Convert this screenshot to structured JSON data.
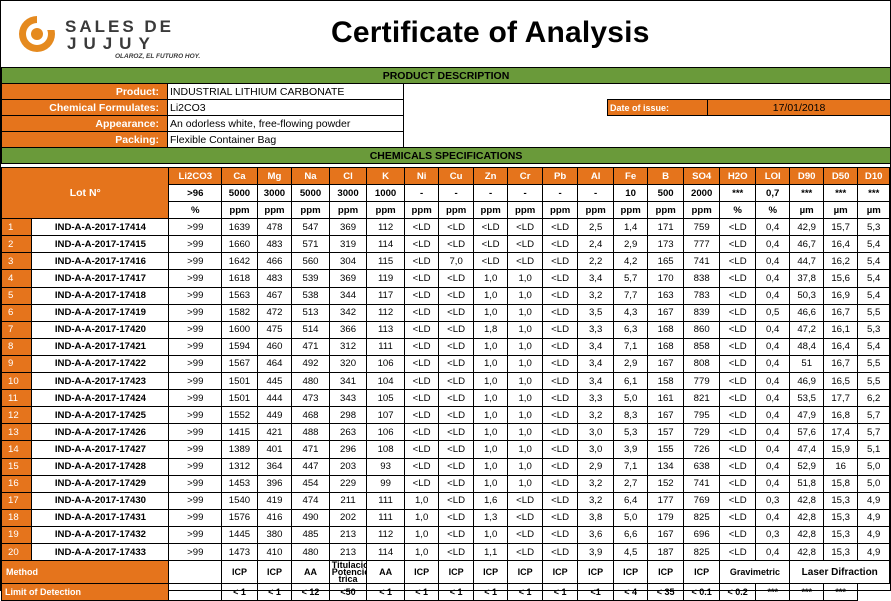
{
  "brand": {
    "line1": "SALES DE",
    "line2": "JUJUY",
    "tagline": "OLAROZ, EL FUTURO HOY."
  },
  "title": "Certificate of Analysis",
  "product_description_title": "PRODUCT DESCRIPTION",
  "product": {
    "label": "Product:",
    "value": "INDUSTRIAL LITHIUM CARBONATE"
  },
  "formula": {
    "label": "Chemical Formulates:",
    "value": "Li2CO3"
  },
  "appearance": {
    "label": "Appearance:",
    "value": "An odorless white, free-flowing powder"
  },
  "packing": {
    "label": "Packing:",
    "value": "Flexible Container Bag"
  },
  "date_of_issue": {
    "label": "Date of issue:",
    "value": "17/01/2018"
  },
  "specs_title": "CHEMICALS SPECIFICATIONS",
  "lot_header": "Lot N°",
  "columns": [
    "Li2CO3",
    "Ca",
    "Mg",
    "Na",
    "Cl",
    "K",
    "Ni",
    "Cu",
    "Zn",
    "Cr",
    "Pb",
    "Al",
    "Fe",
    "B",
    "SO4",
    "H2O",
    "LOI",
    "D90",
    "D50",
    "D10"
  ],
  "spec_limits": [
    ">96",
    "5000",
    "3000",
    "5000",
    "3000",
    "1000",
    "-",
    "-",
    "-",
    "-",
    "-",
    "-",
    "10",
    "500",
    "2000",
    "***",
    "0,7",
    "***",
    "***",
    "***"
  ],
  "units": [
    "%",
    "ppm",
    "ppm",
    "ppm",
    "ppm",
    "ppm",
    "ppm",
    "ppm",
    "ppm",
    "ppm",
    "ppm",
    "ppm",
    "ppm",
    "ppm",
    "ppm",
    "%",
    "%",
    "µm",
    "µm",
    "µm"
  ],
  "rows": [
    {
      "n": "1",
      "lot": "IND-A-A-2017-17414",
      "v": [
        ">99",
        "1639",
        "478",
        "547",
        "369",
        "112",
        "<LD",
        "<LD",
        "<LD",
        "<LD",
        "<LD",
        "2,5",
        "1,4",
        "171",
        "759",
        "<LD",
        "0,4",
        "42,9",
        "15,7",
        "5,3"
      ]
    },
    {
      "n": "2",
      "lot": "IND-A-A-2017-17415",
      "v": [
        ">99",
        "1660",
        "483",
        "571",
        "319",
        "114",
        "<LD",
        "<LD",
        "<LD",
        "<LD",
        "<LD",
        "2,4",
        "2,9",
        "173",
        "777",
        "<LD",
        "0,4",
        "46,7",
        "16,4",
        "5,4"
      ]
    },
    {
      "n": "3",
      "lot": "IND-A-A-2017-17416",
      "v": [
        ">99",
        "1642",
        "466",
        "560",
        "304",
        "115",
        "<LD",
        "7,0",
        "<LD",
        "<LD",
        "<LD",
        "2,2",
        "4,2",
        "165",
        "741",
        "<LD",
        "0,4",
        "44,7",
        "16,2",
        "5,4"
      ]
    },
    {
      "n": "4",
      "lot": "IND-A-A-2017-17417",
      "v": [
        ">99",
        "1618",
        "483",
        "539",
        "369",
        "119",
        "<LD",
        "<LD",
        "1,0",
        "1,0",
        "<LD",
        "3,4",
        "5,7",
        "170",
        "838",
        "<LD",
        "0,4",
        "37,8",
        "15,6",
        "5,4"
      ]
    },
    {
      "n": "5",
      "lot": "IND-A-A-2017-17418",
      "v": [
        ">99",
        "1563",
        "467",
        "538",
        "344",
        "117",
        "<LD",
        "<LD",
        "1,0",
        "1,0",
        "<LD",
        "3,2",
        "7,7",
        "163",
        "783",
        "<LD",
        "0,4",
        "50,3",
        "16,9",
        "5,4"
      ]
    },
    {
      "n": "6",
      "lot": "IND-A-A-2017-17419",
      "v": [
        ">99",
        "1582",
        "472",
        "513",
        "342",
        "112",
        "<LD",
        "<LD",
        "1,0",
        "1,0",
        "<LD",
        "3,5",
        "4,3",
        "167",
        "839",
        "<LD",
        "0,5",
        "46,6",
        "16,7",
        "5,5"
      ]
    },
    {
      "n": "7",
      "lot": "IND-A-A-2017-17420",
      "v": [
        ">99",
        "1600",
        "475",
        "514",
        "366",
        "113",
        "<LD",
        "<LD",
        "1,8",
        "1,0",
        "<LD",
        "3,3",
        "6,3",
        "168",
        "860",
        "<LD",
        "0,4",
        "47,2",
        "16,1",
        "5,3"
      ]
    },
    {
      "n": "8",
      "lot": "IND-A-A-2017-17421",
      "v": [
        ">99",
        "1594",
        "460",
        "471",
        "312",
        "111",
        "<LD",
        "<LD",
        "1,0",
        "1,0",
        "<LD",
        "3,4",
        "7,1",
        "168",
        "858",
        "<LD",
        "0,4",
        "48,4",
        "16,4",
        "5,4"
      ]
    },
    {
      "n": "9",
      "lot": "IND-A-A-2017-17422",
      "v": [
        ">99",
        "1567",
        "464",
        "492",
        "320",
        "106",
        "<LD",
        "<LD",
        "1,0",
        "1,0",
        "<LD",
        "3,4",
        "2,9",
        "167",
        "808",
        "<LD",
        "0,4",
        "51",
        "16,7",
        "5,5"
      ]
    },
    {
      "n": "10",
      "lot": "IND-A-A-2017-17423",
      "v": [
        ">99",
        "1501",
        "445",
        "480",
        "341",
        "104",
        "<LD",
        "<LD",
        "1,0",
        "1,0",
        "<LD",
        "3,4",
        "6,1",
        "158",
        "779",
        "<LD",
        "0,4",
        "46,9",
        "16,5",
        "5,5"
      ]
    },
    {
      "n": "11",
      "lot": "IND-A-A-2017-17424",
      "v": [
        ">99",
        "1501",
        "444",
        "473",
        "343",
        "105",
        "<LD",
        "<LD",
        "1,0",
        "1,0",
        "<LD",
        "3,3",
        "5,0",
        "161",
        "821",
        "<LD",
        "0,4",
        "53,5",
        "17,7",
        "6,2"
      ]
    },
    {
      "n": "12",
      "lot": "IND-A-A-2017-17425",
      "v": [
        ">99",
        "1552",
        "449",
        "468",
        "298",
        "107",
        "<LD",
        "<LD",
        "1,0",
        "1,0",
        "<LD",
        "3,2",
        "8,3",
        "167",
        "795",
        "<LD",
        "0,4",
        "47,9",
        "16,8",
        "5,7"
      ]
    },
    {
      "n": "13",
      "lot": "IND-A-A-2017-17426",
      "v": [
        ">99",
        "1415",
        "421",
        "488",
        "263",
        "106",
        "<LD",
        "<LD",
        "1,0",
        "1,0",
        "<LD",
        "3,0",
        "5,3",
        "157",
        "729",
        "<LD",
        "0,4",
        "57,6",
        "17,4",
        "5,7"
      ]
    },
    {
      "n": "14",
      "lot": "IND-A-A-2017-17427",
      "v": [
        ">99",
        "1389",
        "401",
        "471",
        "296",
        "108",
        "<LD",
        "<LD",
        "1,0",
        "1,0",
        "<LD",
        "3,0",
        "3,9",
        "155",
        "726",
        "<LD",
        "0,4",
        "47,4",
        "15,9",
        "5,1"
      ]
    },
    {
      "n": "15",
      "lot": "IND-A-A-2017-17428",
      "v": [
        ">99",
        "1312",
        "364",
        "447",
        "203",
        "93",
        "<LD",
        "<LD",
        "1,0",
        "1,0",
        "<LD",
        "2,9",
        "7,1",
        "134",
        "638",
        "<LD",
        "0,4",
        "52,9",
        "16",
        "5,0"
      ]
    },
    {
      "n": "16",
      "lot": "IND-A-A-2017-17429",
      "v": [
        ">99",
        "1453",
        "396",
        "454",
        "229",
        "99",
        "<LD",
        "<LD",
        "1,0",
        "1,0",
        "<LD",
        "3,2",
        "2,7",
        "152",
        "741",
        "<LD",
        "0,4",
        "51,8",
        "15,8",
        "5,0"
      ]
    },
    {
      "n": "17",
      "lot": "IND-A-A-2017-17430",
      "v": [
        ">99",
        "1540",
        "419",
        "474",
        "211",
        "111",
        "1,0",
        "<LD",
        "1,6",
        "<LD",
        "<LD",
        "3,2",
        "6,4",
        "177",
        "769",
        "<LD",
        "0,3",
        "42,8",
        "15,3",
        "4,9"
      ]
    },
    {
      "n": "18",
      "lot": "IND-A-A-2017-17431",
      "v": [
        ">99",
        "1576",
        "416",
        "490",
        "202",
        "111",
        "1,0",
        "<LD",
        "1,3",
        "<LD",
        "<LD",
        "3,8",
        "5,0",
        "179",
        "825",
        "<LD",
        "0,4",
        "42,8",
        "15,3",
        "4,9"
      ]
    },
    {
      "n": "19",
      "lot": "IND-A-A-2017-17432",
      "v": [
        ">99",
        "1445",
        "380",
        "485",
        "213",
        "112",
        "1,0",
        "<LD",
        "1,0",
        "<LD",
        "<LD",
        "3,6",
        "6,6",
        "167",
        "696",
        "<LD",
        "0,3",
        "42,8",
        "15,3",
        "4,9"
      ]
    },
    {
      "n": "20",
      "lot": "IND-A-A-2017-17433",
      "v": [
        ">99",
        "1473",
        "410",
        "480",
        "213",
        "114",
        "1,0",
        "<LD",
        "1,1",
        "<LD",
        "<LD",
        "3,9",
        "4,5",
        "187",
        "825",
        "<LD",
        "0,4",
        "42,8",
        "15,3",
        "4,9"
      ]
    }
  ],
  "method": {
    "label": "Method",
    "values": [
      "ICP",
      "ICP",
      "AA",
      "Titulacion Potenciome trica",
      "AA",
      "ICP",
      "ICP",
      "ICP",
      "ICP",
      "ICP",
      "ICP",
      "ICP",
      "ICP",
      "ICP"
    ],
    "gravimetric": "Gravimetric",
    "laser": "Laser Difraction"
  },
  "lod": {
    "label": "Limit of Detection",
    "values": [
      "< 1",
      "< 1",
      "< 12",
      "<50",
      "< 1",
      "< 1",
      "< 1",
      "< 1",
      "< 1",
      "< 1",
      "<1",
      "< 4",
      "< 35",
      "< 0.1",
      "< 0.2",
      "***",
      "***",
      "***"
    ]
  }
}
